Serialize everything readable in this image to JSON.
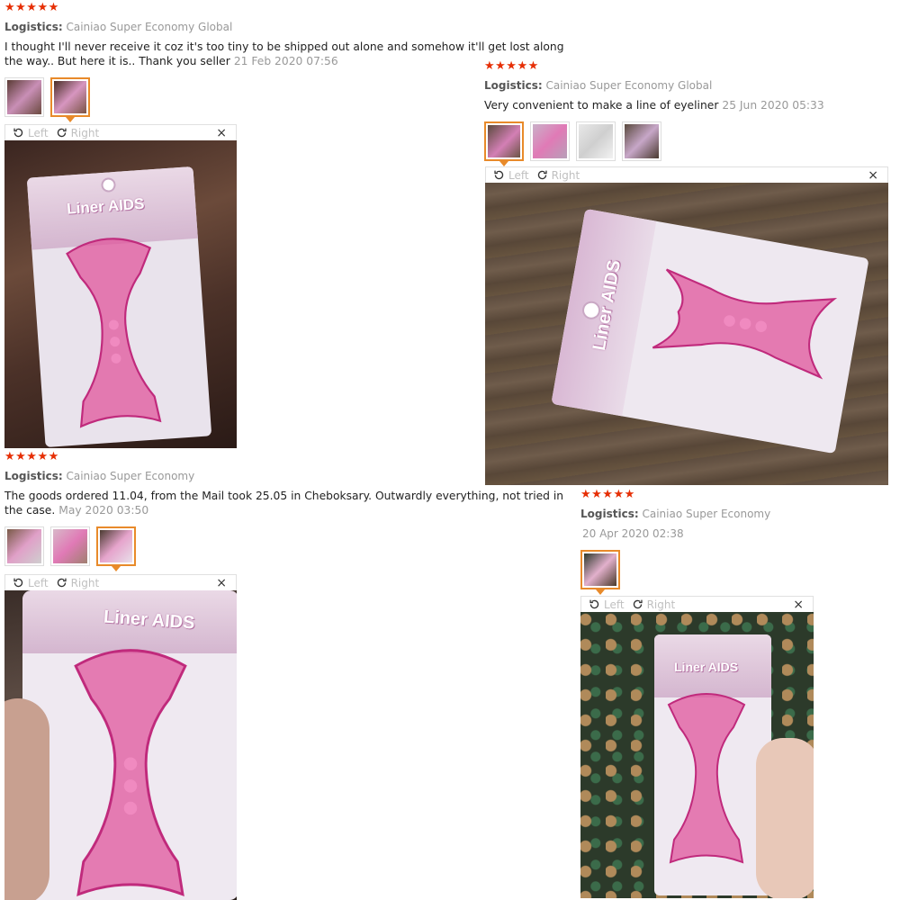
{
  "colors": {
    "star": "#e62e04",
    "active_thumb": "#e88a2a",
    "tool_pink": "#e0559c"
  },
  "viewer": {
    "left_label": "Left",
    "right_label": "Right",
    "close_label": "×",
    "left_icon": "rotate-left-icon",
    "right_icon": "rotate-right-icon"
  },
  "reviews": [
    {
      "stars": "★★★★★",
      "logistics_label": "Logistics:",
      "logistics_value": "Cainiao Super Economy Global",
      "text": "I thought I'll never receive it coz it's too tiny to be shipped out alone and somehow it'll get lost along the way.. But here it is.. Thank you seller",
      "date": "21 Feb 2020 07:56",
      "photo_text": "Liner AIDS"
    },
    {
      "stars": "★★★★★",
      "logistics_label": "Logistics:",
      "logistics_value": "Cainiao Super Economy Global",
      "text": "Very convenient to make a line of eyeliner",
      "date": "25 Jun 2020 05:33",
      "photo_text": "Liner AIDS"
    },
    {
      "stars": "★★★★★",
      "logistics_label": "Logistics:",
      "logistics_value": "Cainiao Super Economy",
      "text": "The goods ordered 11.04, from the Mail took 25.05 in Cheboksary. Outwardly everything, not tried in the case.",
      "date": "May 2020 03:50",
      "photo_text": "Liner AIDS"
    },
    {
      "stars": "★★★★★",
      "logistics_label": "Logistics:",
      "logistics_value": "Cainiao Super Economy",
      "date": "20 Apr 2020 02:38",
      "photo_text": "Liner AIDS"
    }
  ]
}
